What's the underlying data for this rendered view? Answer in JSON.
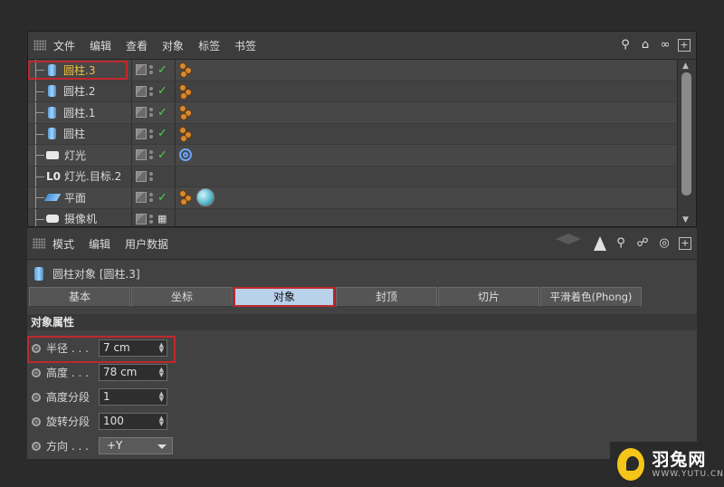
{
  "object_manager": {
    "menu": [
      "文件",
      "编辑",
      "查看",
      "对象",
      "标签",
      "书签"
    ],
    "icons_right": [
      "search-icon",
      "home-icon",
      "link-icon",
      "plus-box-icon"
    ],
    "objects": [
      {
        "name": "圆柱.3",
        "icon": "cylinder-icon",
        "selected": true,
        "enabled": true,
        "tag": "phong-tag"
      },
      {
        "name": "圆柱.2",
        "icon": "cylinder-icon",
        "selected": false,
        "enabled": true,
        "tag": "phong-tag"
      },
      {
        "name": "圆柱.1",
        "icon": "cylinder-icon",
        "selected": false,
        "enabled": true,
        "tag": "phong-tag"
      },
      {
        "name": "圆柱",
        "icon": "cylinder-icon",
        "selected": false,
        "enabled": true,
        "tag": "phong-tag"
      },
      {
        "name": "灯光",
        "icon": "light-icon",
        "selected": false,
        "enabled": true,
        "tag": "target-tag"
      },
      {
        "name": "灯光.目标.2",
        "icon": "null-target-icon",
        "selected": false,
        "enabled": false,
        "tag": ""
      },
      {
        "name": "平面",
        "icon": "plane-icon",
        "selected": false,
        "enabled": true,
        "tag": "phong-material-tag"
      },
      {
        "name": "摄像机",
        "icon": "camera-icon",
        "selected": false,
        "enabled": false,
        "tag": ""
      }
    ]
  },
  "attribute_manager": {
    "menu": [
      "模式",
      "编辑",
      "用户数据"
    ],
    "icons_right": [
      "back-forward-icon",
      "arrow-up-icon",
      "search-icon",
      "lock-icon",
      "target-icon",
      "plus-box-icon"
    ],
    "title": "圆柱对象 [圆柱.3]",
    "tabs": [
      {
        "label": "基本",
        "active": false
      },
      {
        "label": "坐标",
        "active": false
      },
      {
        "label": "对象",
        "active": true
      },
      {
        "label": "封顶",
        "active": false
      },
      {
        "label": "切片",
        "active": false
      },
      {
        "label": "平滑着色(Phong)",
        "active": false
      }
    ],
    "section": "对象属性",
    "properties": [
      {
        "label": "半径 . . .",
        "value": "7 cm",
        "type": "number"
      },
      {
        "label": "高度 . . .",
        "value": "78 cm",
        "type": "number"
      },
      {
        "label": "高度分段",
        "value": "1",
        "type": "number"
      },
      {
        "label": "旋转分段",
        "value": "100",
        "type": "number"
      },
      {
        "label": "方向 . . .",
        "value": "+Y",
        "type": "dropdown"
      }
    ]
  },
  "watermark": {
    "cn": "羽兔网",
    "en": "WWW.YUTU.CN"
  },
  "colors": {
    "selected_name": "#f0c040",
    "active_tab": "#b9d1ea",
    "highlight_box": "#c0282b",
    "check": "#4cd14c"
  }
}
